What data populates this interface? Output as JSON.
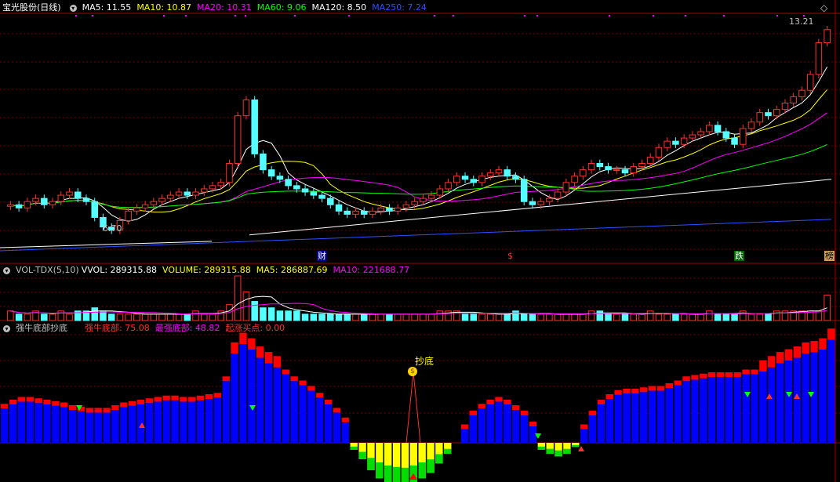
{
  "main": {
    "title": "宝光股份(日线)",
    "ma": [
      {
        "label": "MA5: 11.55",
        "color": "#ffffff"
      },
      {
        "label": "MA10: 10.87",
        "color": "#ffff00"
      },
      {
        "label": "MA20: 10.31",
        "color": "#ff00ff"
      },
      {
        "label": "MA60: 9.06",
        "color": "#00ff00"
      },
      {
        "label": "MA120: 8.50",
        "color": "#ffffff"
      },
      {
        "label": "MA250: 7.24",
        "color": "#3050ff"
      }
    ],
    "high_label": "13.21",
    "low_label": "6.70",
    "markers": [
      "财",
      "$",
      "跌",
      "榜"
    ]
  },
  "vol": {
    "title": "VOL-TDX(5,10)",
    "items": [
      {
        "label": "VVOL: 289315.88",
        "color": "#ffffff"
      },
      {
        "label": "VOLUME: 289315.88",
        "color": "#ffff00"
      },
      {
        "label": "MA5: 286887.69",
        "color": "#ffff00"
      },
      {
        "label": "MA10: 221688.77",
        "color": "#ff00ff"
      }
    ]
  },
  "ind": {
    "title": "强牛底部抄底",
    "items": [
      {
        "label": "强牛底部: 75.08",
        "color": "#ff3030"
      },
      {
        "label": "最强底部: 48.82",
        "color": "#ff00ff"
      },
      {
        "label": "起涨买点: 0.00",
        "color": "#ff3030"
      }
    ],
    "signal_label": "抄底"
  },
  "chart_data": [
    {
      "type": "candlestick",
      "title": "宝光股份(日线)",
      "ohlc_close_approx": [
        7.7,
        7.6,
        7.8,
        7.9,
        7.7,
        7.8,
        8.0,
        8.1,
        7.9,
        7.8,
        7.3,
        7.0,
        6.9,
        7.2,
        7.5,
        7.6,
        7.7,
        7.8,
        7.9,
        8.0,
        8.1,
        8.0,
        8.1,
        8.2,
        8.3,
        8.4,
        9.0,
        10.5,
        11.0,
        9.3,
        8.8,
        8.6,
        8.5,
        8.3,
        8.2,
        8.1,
        8.0,
        7.9,
        7.7,
        7.5,
        7.4,
        7.5,
        7.4,
        7.5,
        7.6,
        7.5,
        7.6,
        7.7,
        7.8,
        7.9,
        8.0,
        8.2,
        8.4,
        8.6,
        8.5,
        8.4,
        8.6,
        8.7,
        8.8,
        8.6,
        8.5,
        7.8,
        7.7,
        7.8,
        7.9,
        8.1,
        8.4,
        8.6,
        8.8,
        9.0,
        8.9,
        8.8,
        8.8,
        8.7,
        8.9,
        9.0,
        9.2,
        9.5,
        9.7,
        9.6,
        9.8,
        9.9,
        10.0,
        10.2,
        10.0,
        9.8,
        9.6,
        10.1,
        10.3,
        10.6,
        10.5,
        10.7,
        10.9,
        11.1,
        11.3,
        11.8,
        12.8,
        13.21
      ],
      "high": 13.21,
      "low": 6.7,
      "ma": {
        "MA5": 11.55,
        "MA10": 10.87,
        "MA20": 10.31,
        "MA60": 9.06,
        "MA120": 8.5,
        "MA250": 7.24
      }
    },
    {
      "type": "bar",
      "title": "VOL-TDX(5,10)",
      "values": [
        3,
        2,
        2,
        3,
        2,
        2,
        3,
        2,
        3,
        3,
        4,
        3,
        2,
        2,
        2,
        2,
        2,
        2,
        2,
        2,
        2,
        2,
        3,
        2,
        2,
        3,
        5,
        14,
        9,
        6,
        4,
        4,
        3,
        3,
        3,
        2,
        2,
        2,
        2,
        2,
        2,
        2,
        2,
        2,
        2,
        2,
        2,
        2,
        2,
        2,
        2,
        3,
        3,
        3,
        2,
        2,
        2,
        2,
        2,
        2,
        3,
        2,
        2,
        2,
        2,
        2,
        2,
        2,
        2,
        3,
        3,
        2,
        2,
        2,
        2,
        2,
        3,
        2,
        2,
        2,
        2,
        2,
        2,
        3,
        2,
        2,
        2,
        3,
        2,
        2,
        2,
        3,
        3,
        3,
        3,
        3,
        3,
        8
      ],
      "VVOL": 289315.88,
      "VOLUME": 289315.88,
      "MA5": 286887.69,
      "MA10": 221688.77
    },
    {
      "type": "bar",
      "title": "强牛底部抄底",
      "values": [
        25,
        28,
        30,
        30,
        29,
        28,
        27,
        26,
        24,
        23,
        22,
        22,
        22,
        24,
        26,
        27,
        28,
        29,
        30,
        31,
        31,
        30,
        30,
        31,
        32,
        33,
        45,
        65,
        72,
        68,
        62,
        58,
        55,
        50,
        45,
        42,
        38,
        33,
        28,
        22,
        15,
        -5,
        -12,
        -20,
        -26,
        -30,
        -32,
        -33,
        -30,
        -26,
        -22,
        -15,
        -8,
        0,
        10,
        20,
        25,
        28,
        30,
        28,
        24,
        20,
        12,
        -5,
        -8,
        -10,
        -8,
        -3,
        10,
        20,
        28,
        32,
        35,
        36,
        36,
        37,
        38,
        38,
        40,
        42,
        45,
        46,
        47,
        48,
        48,
        48,
        48,
        50,
        50,
        52,
        55,
        58,
        60,
        62,
        65,
        66,
        68,
        75.08
      ],
      "强牛底部": 75.08,
      "最强底部": 48.82,
      "起涨买点": 0.0
    }
  ]
}
